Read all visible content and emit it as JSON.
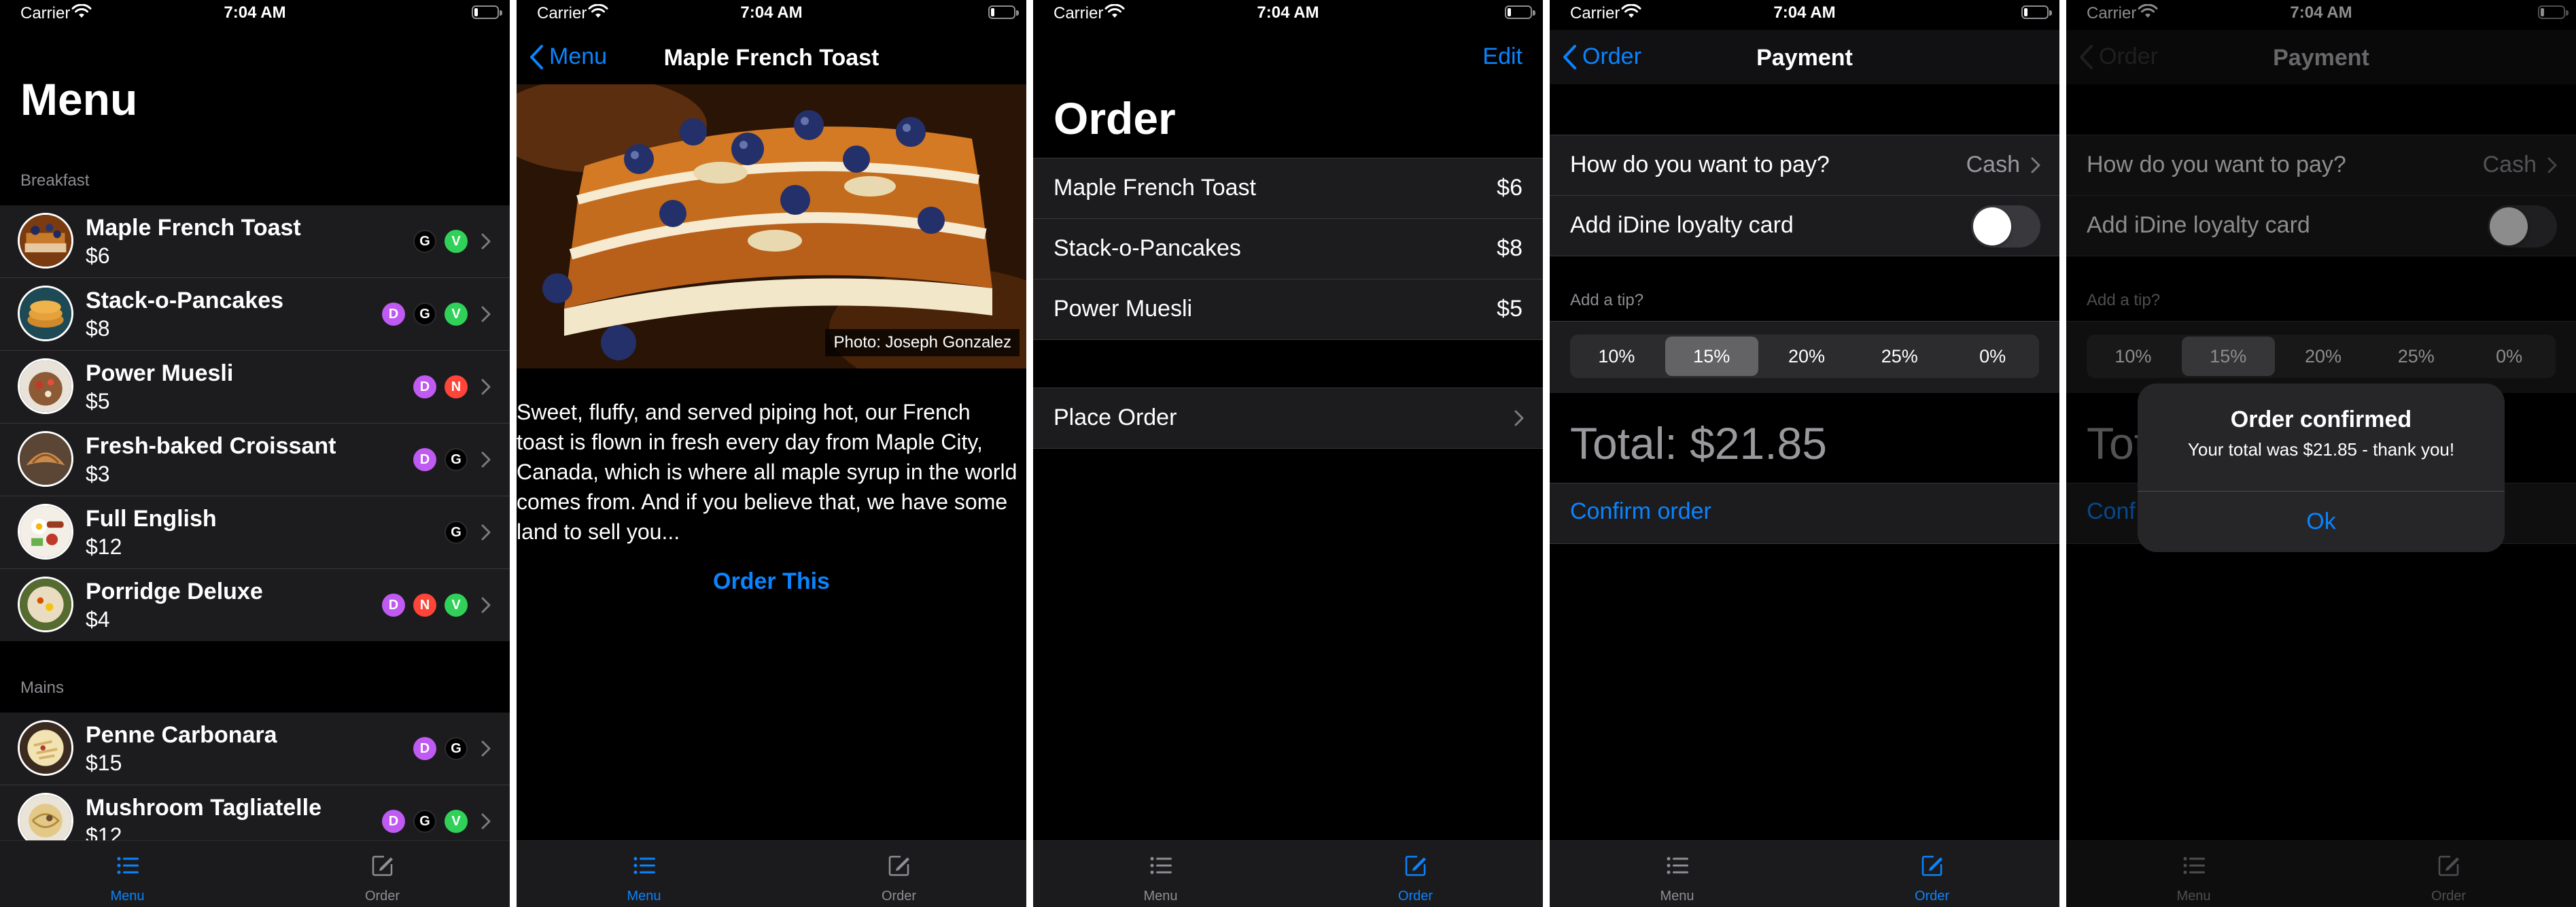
{
  "status": {
    "carrier": "Carrier",
    "time": "7:04 AM"
  },
  "colors": {
    "accent": "#0a84ff",
    "badge_d": "#bf5af2",
    "badge_g": "#000000",
    "badge_v": "#30d158",
    "badge_n": "#ff453a"
  },
  "tabs": {
    "menu": "Menu",
    "order": "Order"
  },
  "menu": {
    "title": "Menu",
    "sections": [
      {
        "header": "Breakfast",
        "items": [
          {
            "name": "Maple French Toast",
            "price": "$6",
            "badges": [
              "G",
              "V"
            ]
          },
          {
            "name": "Stack-o-Pancakes",
            "price": "$8",
            "badges": [
              "D",
              "G",
              "V"
            ]
          },
          {
            "name": "Power Muesli",
            "price": "$5",
            "badges": [
              "D",
              "N"
            ]
          },
          {
            "name": "Fresh-baked Croissant",
            "price": "$3",
            "badges": [
              "D",
              "G"
            ]
          },
          {
            "name": "Full English",
            "price": "$12",
            "badges": [
              "G"
            ]
          },
          {
            "name": "Porridge Deluxe",
            "price": "$4",
            "badges": [
              "D",
              "N",
              "V"
            ]
          }
        ]
      },
      {
        "header": "Mains",
        "items": [
          {
            "name": "Penne Carbonara",
            "price": "$15",
            "badges": [
              "D",
              "G"
            ]
          },
          {
            "name": "Mushroom Tagliatelle",
            "price": "$12",
            "badges": [
              "D",
              "G",
              "V"
            ]
          }
        ]
      }
    ]
  },
  "detail": {
    "back": "Menu",
    "title": "Maple French Toast",
    "photo_credit": "Photo: Joseph Gonzalez",
    "description": "Sweet, fluffy, and served piping hot, our French toast is flown in fresh every day from Maple City, Canada, which is where all maple syrup in the world comes from. And if you believe that, we have some land to sell you...",
    "action": "Order This"
  },
  "order": {
    "title": "Order",
    "edit": "Edit",
    "items": [
      {
        "name": "Maple French Toast",
        "price": "$6"
      },
      {
        "name": "Stack-o-Pancakes",
        "price": "$8"
      },
      {
        "name": "Power Muesli",
        "price": "$5"
      }
    ],
    "place_order": "Place Order"
  },
  "payment": {
    "back": "Order",
    "title": "Payment",
    "pay_question": "How do you want to pay?",
    "pay_value": "Cash",
    "loyalty": "Add iDine loyalty card",
    "loyalty_on": false,
    "tip_header": "Add a tip?",
    "tips": [
      "10%",
      "15%",
      "20%",
      "25%",
      "0%"
    ],
    "selected_tip": "15%",
    "total": "Total: $21.85",
    "total_partial": "Tot",
    "confirm": "Confirm order",
    "confirm_partial": "Conf"
  },
  "alert": {
    "title": "Order confirmed",
    "message": "Your total was $21.85 - thank you!",
    "button": "Ok"
  }
}
